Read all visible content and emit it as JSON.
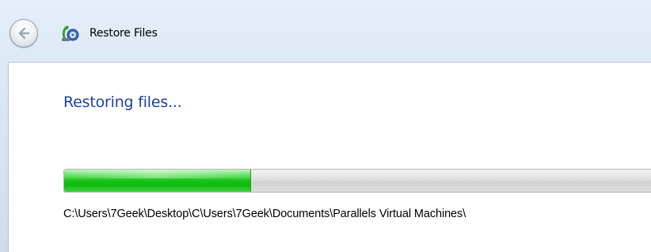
{
  "window": {
    "title": "Restore Files",
    "back_icon": "back-arrow-icon",
    "app_icon": "restore-files-icon"
  },
  "main": {
    "heading": "Restoring files...",
    "progress_percent": 31,
    "current_path": "C:\\Users\\7Geek\\Desktop\\C\\Users\\7Geek\\Documents\\Parallels Virtual Machines\\"
  },
  "colors": {
    "heading": "#1e3fa0",
    "progress_fill": "#16c316",
    "frame": "#d9e6f3"
  }
}
